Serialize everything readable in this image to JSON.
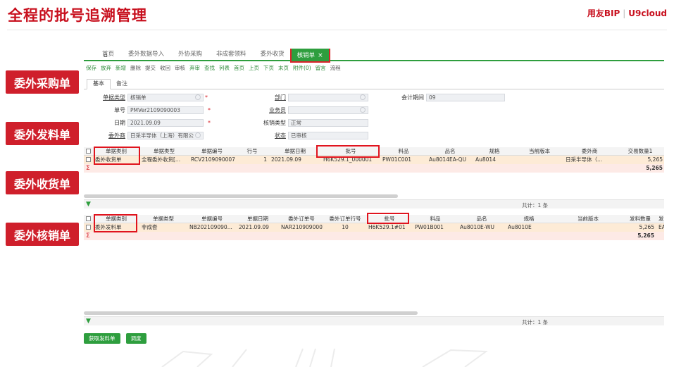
{
  "slide": {
    "title": "全程的批号追溯管理",
    "brand_left": "用友BIP",
    "brand_sep": "|",
    "brand_right": "U9cloud"
  },
  "callouts": [
    "委外采购单",
    "委外发料单",
    "委外收货单",
    "委外核销单"
  ],
  "tabs": [
    {
      "label": "首页"
    },
    {
      "label": "委外数据导入"
    },
    {
      "label": "外协采购"
    },
    {
      "label": "非成套领料"
    },
    {
      "label": "委外收货"
    },
    {
      "label": "核销单",
      "close": "×"
    }
  ],
  "toolbar": [
    {
      "label": "保存",
      "style": "g"
    },
    {
      "label": "放弃",
      "style": "g"
    },
    {
      "label": "新增",
      "style": "g"
    },
    {
      "label": "删除",
      "style": "n"
    },
    {
      "label": "提交",
      "style": "n"
    },
    {
      "label": "收回",
      "style": "n"
    },
    {
      "label": "审核",
      "style": "n"
    },
    {
      "label": "弃审",
      "style": "g"
    },
    {
      "label": "查找",
      "style": "g"
    },
    {
      "label": "列表",
      "style": "g"
    },
    {
      "label": "首页",
      "style": "g"
    },
    {
      "label": "上页",
      "style": "g"
    },
    {
      "label": "下页",
      "style": "g"
    },
    {
      "label": "末页",
      "style": "g"
    },
    {
      "label": "附件(0)",
      "style": "g"
    },
    {
      "label": "留言",
      "style": "g"
    },
    {
      "label": "流程",
      "style": "n"
    }
  ],
  "subtabs": [
    "基本",
    "备注"
  ],
  "form": {
    "doc_type_label": "单据类型",
    "doc_type_value": "核销单",
    "doc_no_label": "单号",
    "doc_no_value": "PMVer2109090003",
    "date_label": "日期",
    "date_value": "2021.09.09",
    "vendor_label": "委外商",
    "vendor_value": "日采半导体（上海）有限公",
    "dept_label": "部门",
    "dept_value": "",
    "salesman_label": "业务员",
    "salesman_value": "",
    "verify_type_label": "核销类型",
    "verify_type_value": "正常",
    "status_label": "状态",
    "status_value": "已审核",
    "period_label": "会计期间",
    "period_value": "09",
    "required_mark": "*"
  },
  "grid1": {
    "headers": [
      "单据类别",
      "单据类型",
      "单据编号",
      "行号",
      "单据日期",
      "批号",
      "料品",
      "品名",
      "规格",
      "当前版本",
      "委外商",
      "交易数量1"
    ],
    "row": [
      "委外收货单",
      "全程委外收货[...",
      "RCV2109090007",
      "1",
      "2021.09.09",
      "H6K529.1_000001",
      "PW01C001",
      "Au8014EA-QU",
      "Au8014",
      "",
      "日采半导体（...",
      "5,265"
    ],
    "sum_symbol": "Σ",
    "sum_value": "5,265",
    "total_text": "共计：1 条"
  },
  "grid2": {
    "headers": [
      "单据类别",
      "单据类型",
      "单据编号",
      "单据日期",
      "委外订单号",
      "委外订单行号",
      "批号",
      "料品",
      "品名",
      "规格",
      "当前版本",
      "发料数量",
      "发"
    ],
    "row": [
      "委外发料单",
      "非成套",
      "NB202109090...",
      "2021.09.09",
      "NAR2109090001",
      "10",
      "H6K529.1#01",
      "PW01B001",
      "Au8010E-WU",
      "Au8010E",
      "",
      "5,265",
      "EA"
    ],
    "sum_symbol": "Σ",
    "sum_value": "5,265",
    "total_text": "共计：1 条"
  },
  "buttons": {
    "fetch_label": "获取发料单",
    "adjust_label": "调度"
  },
  "colors": {
    "accent_red": "#c8101e",
    "app_green": "#2e9e3e",
    "highlight_box": "#e0141e"
  }
}
